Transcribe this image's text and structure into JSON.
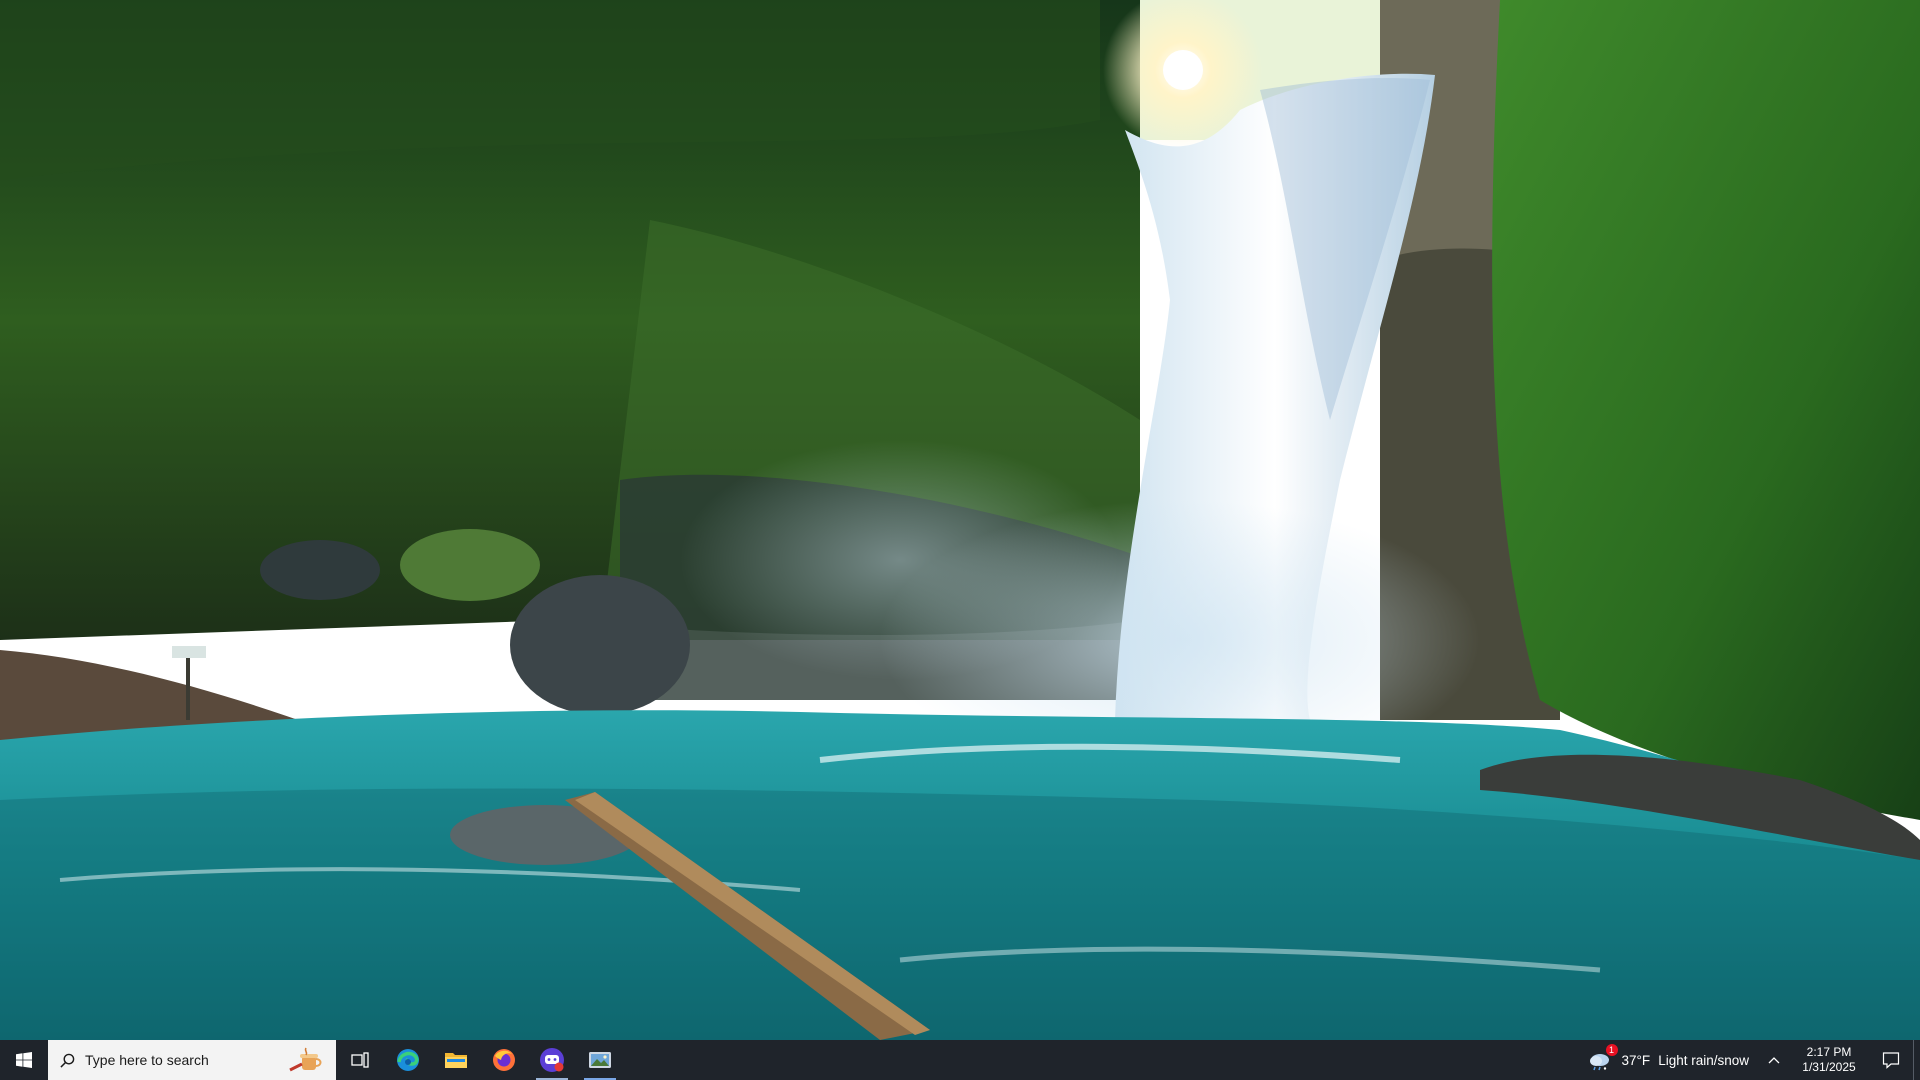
{
  "taskbar": {
    "search_placeholder": "Type here to search",
    "apps": [
      {
        "name": "Task View"
      },
      {
        "name": "Microsoft Edge"
      },
      {
        "name": "File Explorer"
      },
      {
        "name": "Firefox"
      },
      {
        "name": "Chat app"
      },
      {
        "name": "Image viewer"
      }
    ],
    "weather": {
      "temperature": "37°F",
      "condition": "Light rain/snow",
      "badge": "1"
    },
    "clock": {
      "time": "2:17 PM",
      "date": "1/31/2025"
    }
  },
  "colors": {
    "taskbar_bg": "#1f242b",
    "search_bg": "#f3f3f3",
    "accent": "#7aa7e6"
  }
}
